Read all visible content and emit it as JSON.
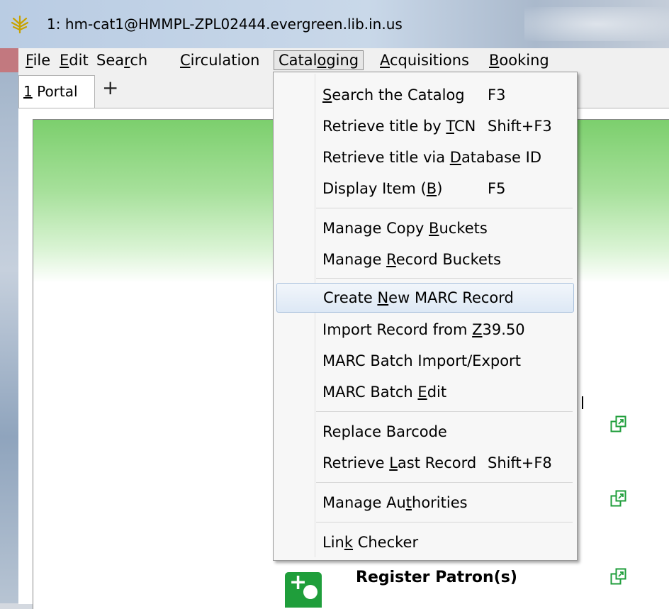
{
  "window": {
    "title": "1: hm-cat1@HMMPL-ZPL02444.evergreen.lib.in.us",
    "icon": "evergreen-leaf-icon"
  },
  "menubar": {
    "items": [
      {
        "label": "File"
      },
      {
        "label": "Edit"
      },
      {
        "label": "Search"
      },
      {
        "label": "Circulation"
      },
      {
        "label": "Cataloging"
      },
      {
        "label": "Acquisitions"
      },
      {
        "label": "Booking"
      }
    ],
    "active": "Cataloging"
  },
  "tabs": [
    {
      "label": "1 Portal"
    }
  ],
  "add_tab_label": "+",
  "cataloging_menu": {
    "groups": [
      [
        {
          "label": "Search the Catalog",
          "shortcut": "F3"
        },
        {
          "label": "Retrieve title by TCN",
          "shortcut": "Shift+F3"
        },
        {
          "label": "Retrieve title via Database ID",
          "shortcut": ""
        },
        {
          "label": "Display Item (B)",
          "shortcut": "F5"
        }
      ],
      [
        {
          "label": "Manage Copy Buckets",
          "shortcut": ""
        },
        {
          "label": "Manage Record Buckets",
          "shortcut": ""
        }
      ],
      [
        {
          "label": "Create New MARC Record",
          "shortcut": "",
          "highlighted": true
        },
        {
          "label": "Import Record from Z39.50",
          "shortcut": ""
        },
        {
          "label": "MARC Batch Import/Export",
          "shortcut": ""
        },
        {
          "label": "MARC Batch Edit",
          "shortcut": ""
        }
      ],
      [
        {
          "label": "Replace Barcode",
          "shortcut": ""
        },
        {
          "label": "Retrieve Last Record",
          "shortcut": "Shift+F8"
        }
      ],
      [
        {
          "label": "Manage Authorities",
          "shortcut": ""
        }
      ],
      [
        {
          "label": "Link Checker",
          "shortcut": ""
        }
      ]
    ]
  },
  "portal": {
    "register_patron_label": "Register Patron(s)"
  },
  "colors": {
    "accent_green": "#1f9e3b",
    "menu_highlight": "#dde8f5"
  }
}
